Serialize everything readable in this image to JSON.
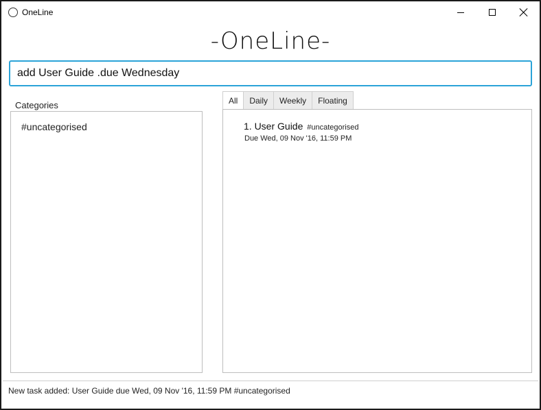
{
  "window": {
    "title": "OneLine",
    "app_icon": "circle-app-icon",
    "controls": [
      "minimize-icon",
      "maximize-icon",
      "close-icon"
    ]
  },
  "header": {
    "logo_text": "-OneLine-"
  },
  "command": {
    "value": "add User Guide .due Wednesday",
    "accent_color": "#2aa3d8"
  },
  "categories": {
    "label": "Categories",
    "items": [
      {
        "label": "#uncategorised"
      }
    ]
  },
  "tabs": [
    {
      "label": "All",
      "active": true
    },
    {
      "label": "Daily",
      "active": false
    },
    {
      "label": "Weekly",
      "active": false
    },
    {
      "label": "Floating",
      "active": false
    }
  ],
  "tasks": [
    {
      "title": "1. User Guide",
      "tag": "#uncategorised",
      "due": "Due Wed, 09 Nov '16, 11:59 PM"
    }
  ],
  "status": {
    "message": "New task added: User Guide due Wed, 09 Nov '16, 11:59 PM #uncategorised"
  }
}
